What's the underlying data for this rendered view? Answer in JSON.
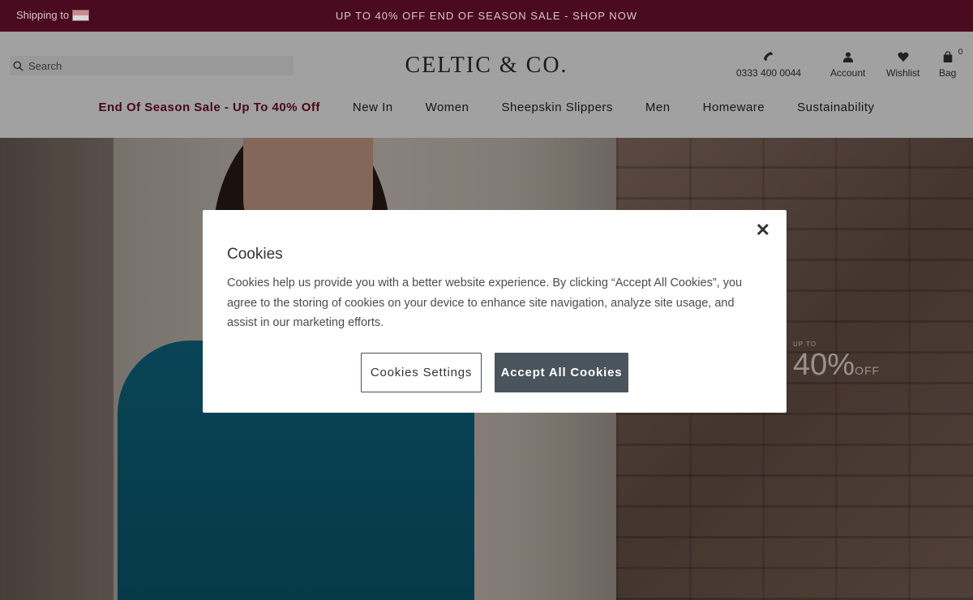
{
  "promo_bar": {
    "shipping_label": "Shipping to",
    "message": "UP TO 40% OFF END OF SEASON SALE - SHOP NOW"
  },
  "header": {
    "search_placeholder": "Search",
    "logo_text": "CELTIC & CO.",
    "phone": "0333 400 0044",
    "account_label": "Account",
    "wishlist_label": "Wishlist",
    "bag_label": "Bag",
    "bag_count": "0"
  },
  "nav": {
    "items": [
      "End Of Season Sale - Up To 40% Off",
      "New In",
      "Women",
      "Sheepskin Slippers",
      "Men",
      "Homeware",
      "Sustainability"
    ]
  },
  "hero": {
    "upto": "UP TO",
    "percent": "40%",
    "off": "OFF"
  },
  "cookie_modal": {
    "title": "Cookies",
    "description": "Cookies help us provide you with a better website experience. By clicking “Accept All Cookies”, you agree to the storing of cookies on your device to enhance site navigation, analyze site usage, and assist in our marketing efforts.",
    "settings_button": "Cookies Settings",
    "accept_button": "Accept All Cookies",
    "close_symbol": "✕"
  },
  "colors": {
    "promo_bg": "#4a0a1f",
    "sale_nav": "#6a0d24",
    "accept_bg": "#4a545c"
  }
}
